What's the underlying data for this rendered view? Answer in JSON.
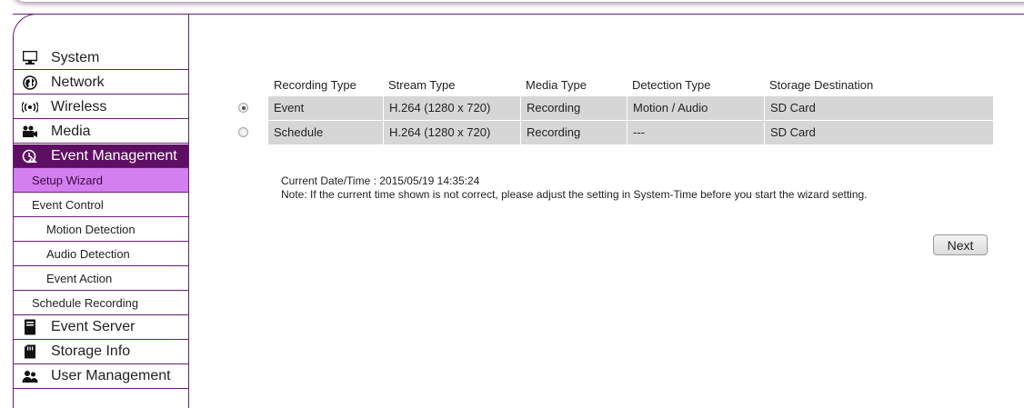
{
  "sidebar": {
    "items": [
      {
        "label": "System",
        "icon": "monitor-icon"
      },
      {
        "label": "Network",
        "icon": "globe-icon"
      },
      {
        "label": "Wireless",
        "icon": "wireless-icon"
      },
      {
        "label": "Media",
        "icon": "media-icon"
      },
      {
        "label": "Event Management",
        "icon": "event-icon"
      }
    ],
    "sub_items": [
      {
        "label": "Setup Wizard"
      },
      {
        "label": "Event Control"
      },
      {
        "label": "Motion Detection"
      },
      {
        "label": "Audio Detection"
      },
      {
        "label": "Event Action"
      },
      {
        "label": "Schedule Recording"
      }
    ],
    "bottom_items": [
      {
        "label": "Event Server",
        "icon": "server-icon"
      },
      {
        "label": "Storage Info",
        "icon": "sd-card-icon"
      },
      {
        "label": "User Management",
        "icon": "users-icon"
      }
    ],
    "active_item": "Event Management",
    "selected_sub_item": "Setup Wizard",
    "accent_color": "#5f0f63",
    "selected_color": "#d37ff0"
  },
  "table": {
    "headers": [
      "Recording Type",
      "Stream Type",
      "Media Type",
      "Detection Type",
      "Storage Destination"
    ],
    "rows": [
      {
        "selected": true,
        "cells": [
          "Event",
          "H.264 (1280 x 720)",
          "Recording",
          "Motion / Audio",
          "SD Card"
        ]
      },
      {
        "selected": false,
        "cells": [
          "Schedule",
          "H.264 (1280 x 720)",
          "Recording",
          "---",
          "SD Card"
        ]
      }
    ]
  },
  "info": {
    "datetime_line": "Current Date/Time : 2015/05/19 14:35:24",
    "note_line": "Note: If the current time shown is not correct, please adjust the setting in System-Time before you start the wizard setting."
  },
  "actions": {
    "next_label": "Next"
  }
}
